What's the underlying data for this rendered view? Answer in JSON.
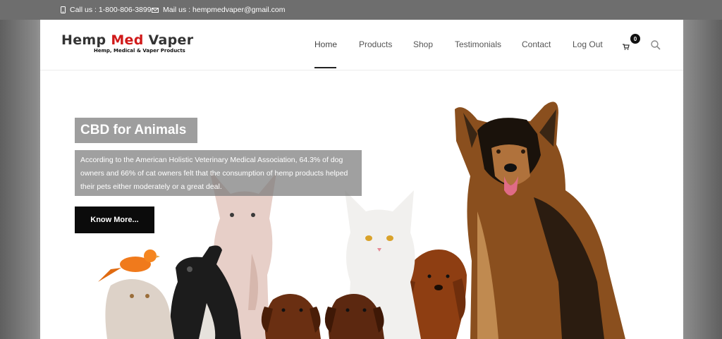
{
  "topbar": {
    "phone": "Call us : 1-800-806-3899",
    "mail": "Mail us : hempmedvaper@gmail.com"
  },
  "logo": {
    "part1": "Hemp",
    "part2": "Med",
    "part3": "Vaper",
    "tagline": "Hemp, Medical & Vaper Products"
  },
  "nav": {
    "items": [
      "Home",
      "Products",
      "Shop",
      "Testimonials",
      "Contact",
      "Log Out"
    ],
    "active": "Home",
    "cart_count": "0"
  },
  "hero": {
    "title": "CBD for Animals",
    "text": "According to the American Holistic Veterinary Medical Association, 64.3% of dog owners and 66% of cat owners felt that the consumption of hemp products helped their pets either moderately or a great deal.",
    "button": "Know More..."
  },
  "colors": {
    "accent": "#d01a1a",
    "topbar": "#6e6e6e",
    "button": "#0b0b0b"
  },
  "icons": [
    "phone-icon",
    "mail-icon",
    "cart-icon",
    "search-icon"
  ]
}
